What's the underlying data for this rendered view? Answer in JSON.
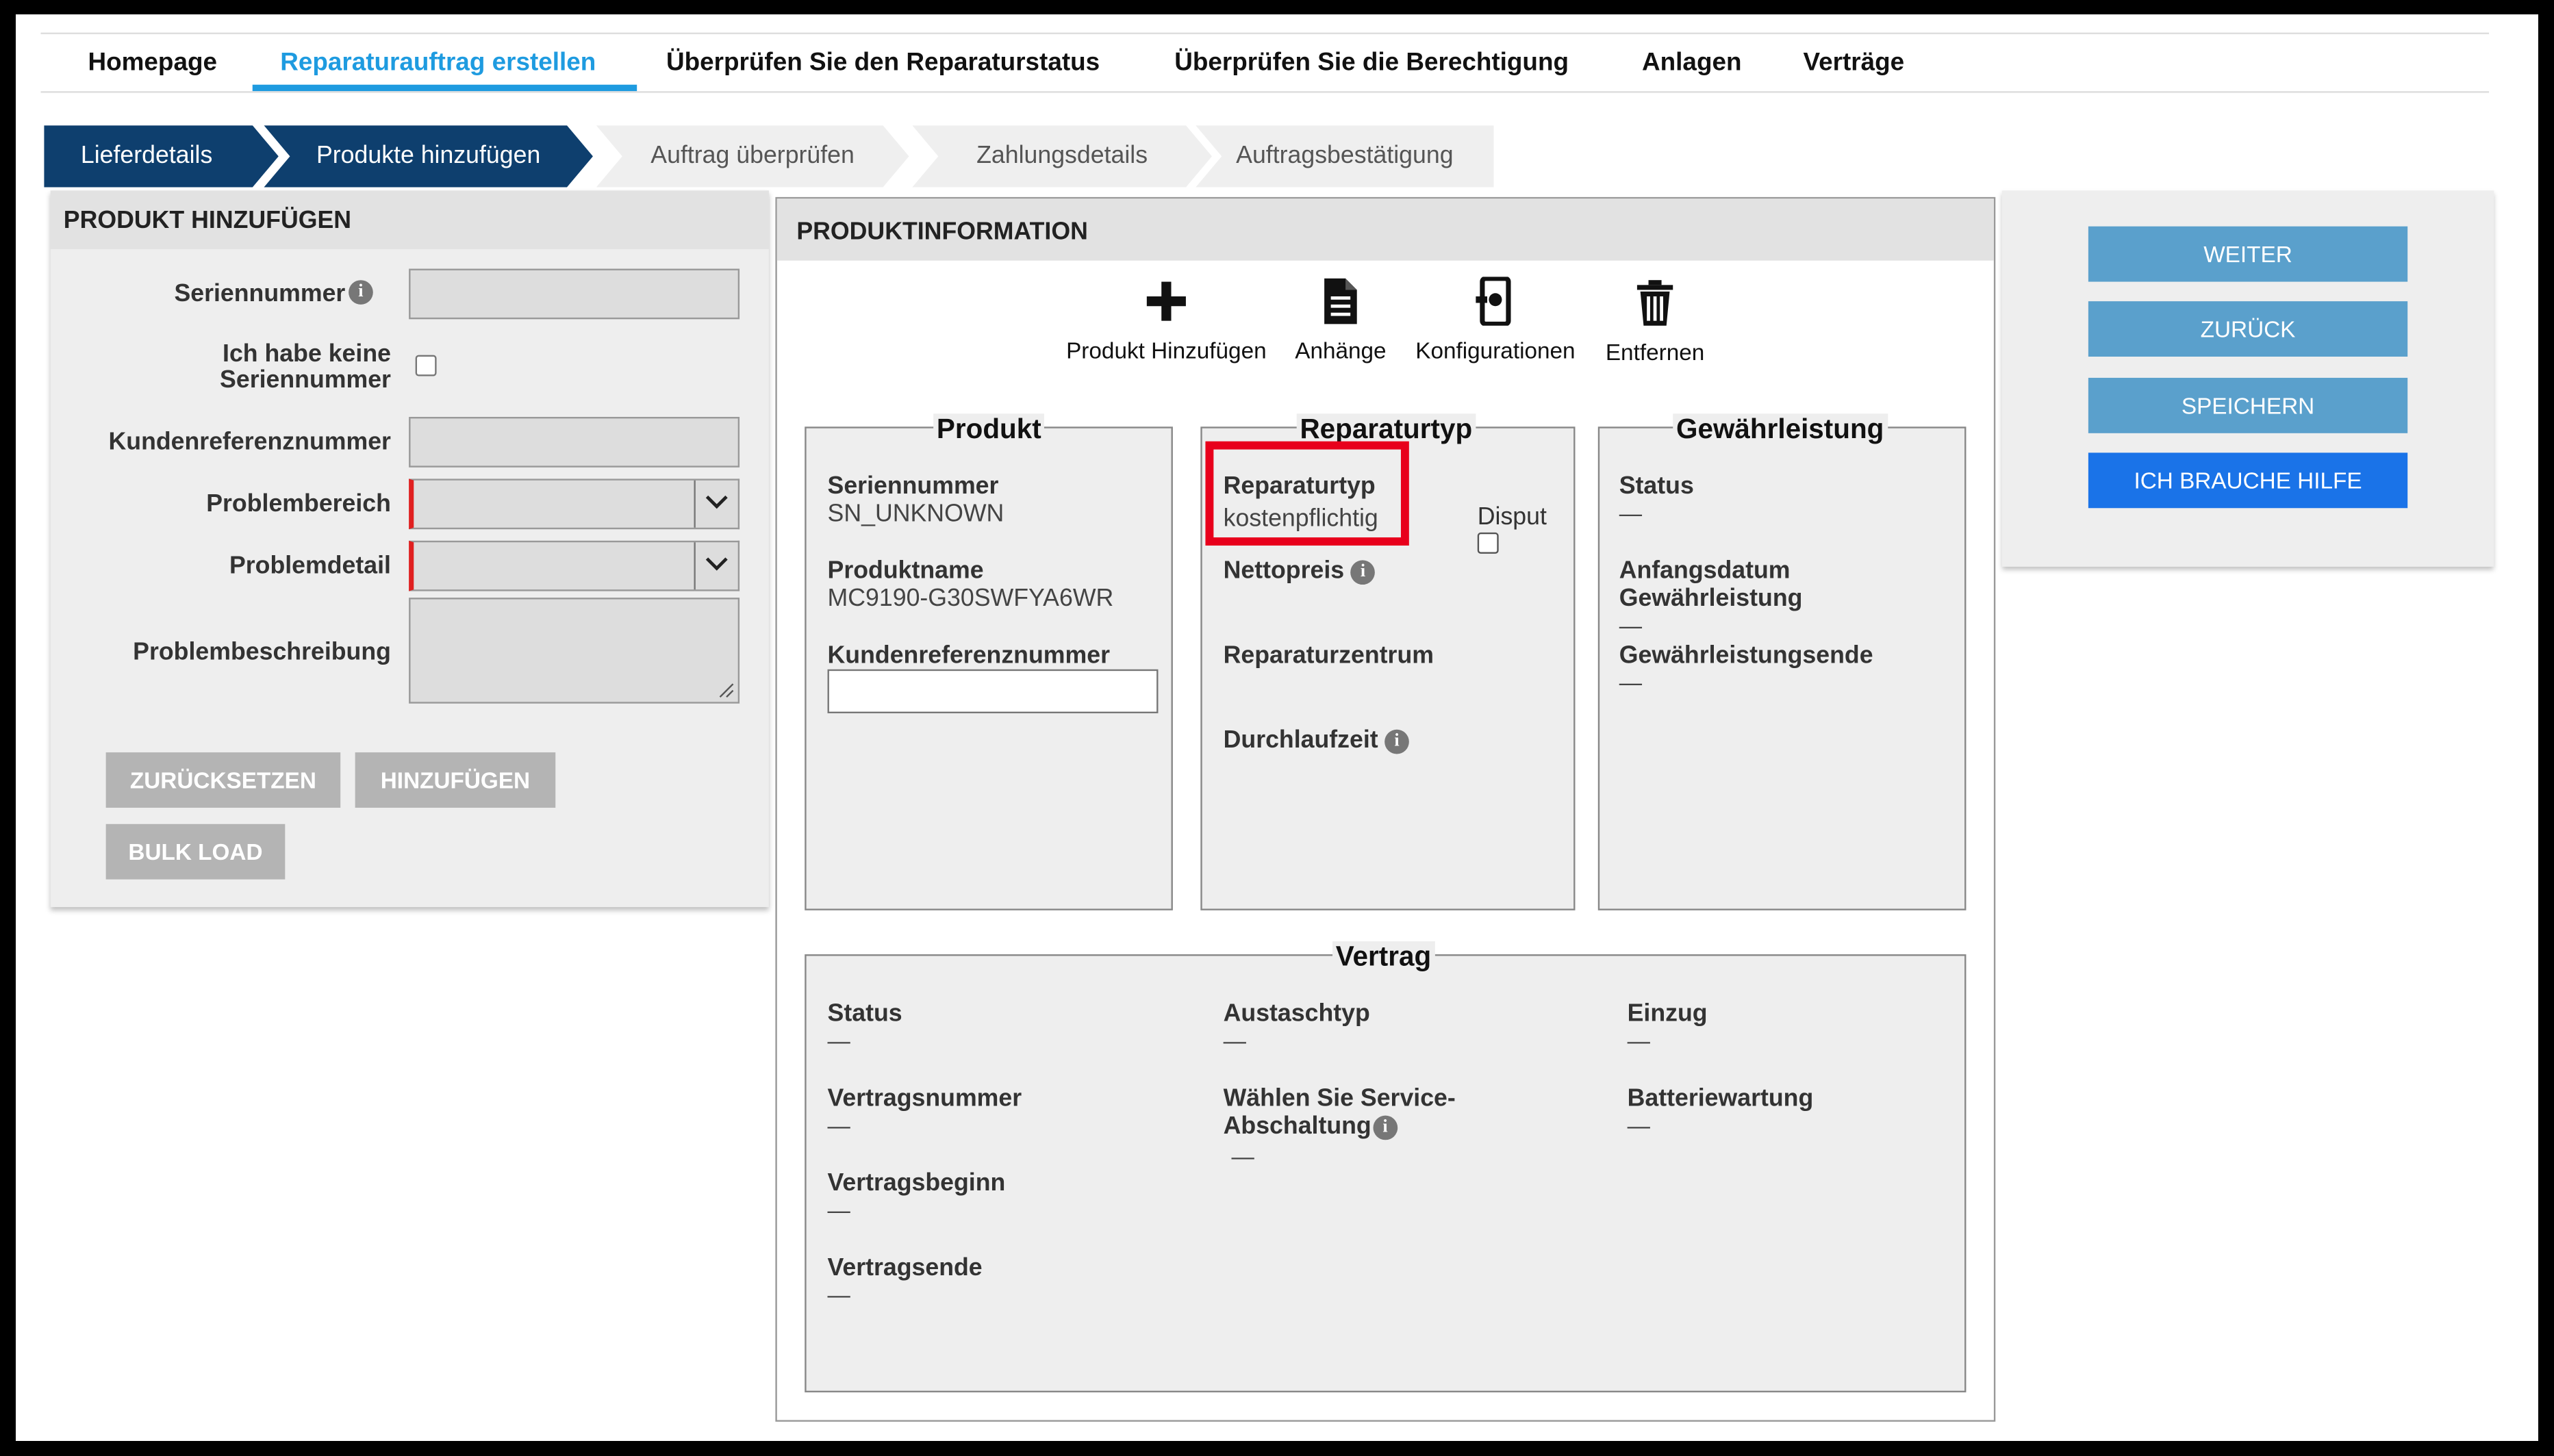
{
  "nav": {
    "items": [
      "Homepage",
      "Reparaturauftrag erstellen",
      "Überprüfen Sie den Reparaturstatus",
      "Überprüfen Sie die Berechtigung",
      "Anlagen",
      "Verträge"
    ]
  },
  "steps": [
    "Lieferdetails",
    "Produkte hinzufügen",
    "Auftrag überprüfen",
    "Zahlungsdetails",
    "Auftragsbestätigung"
  ],
  "left_panel": {
    "title": "PRODUKT HINZUFÜGEN",
    "serial_label": "Seriennummer",
    "no_serial_line1": "Ich habe keine",
    "no_serial_line2": "Seriennummer",
    "customer_ref_label": "Kundenreferenznummer",
    "problem_area_label": "Problembereich",
    "problem_detail_label": "Problemdetail",
    "problem_desc_label": "Problembeschreibung",
    "reset_button": "ZURÜCKSETZEN",
    "add_button": "HINZUFÜGEN",
    "bulk_button": "BULK LOAD"
  },
  "product_info": {
    "title": "PRODUKTINFORMATION",
    "tools": {
      "add": "Produkt Hinzufügen",
      "attachments": "Anhänge",
      "configurations": "Konfigurationen",
      "remove": "Entfernen"
    },
    "product": {
      "title": "Produkt",
      "serial_label": "Seriennummer",
      "serial_value": "SN_UNKNOWN",
      "name_label": "Produktname",
      "name_value": "MC9190-G30SWFYA6WR",
      "ref_label": "Kundenreferenznummer"
    },
    "repair_type": {
      "title": "Reparaturtyp",
      "type_label": "Reparaturtyp",
      "type_value": "kostenpflichtig",
      "dispute_label": "Disput",
      "net_price_label": "Nettopreis",
      "center_label": "Reparaturzentrum",
      "turnaround_label": "Durchlaufzeit"
    },
    "warranty": {
      "title": "Gewährleistung",
      "status_label": "Status",
      "status_value": "—",
      "start_label_1": "Anfangsdatum",
      "start_label_2": "Gewährleistung",
      "start_value": "—",
      "end_label": "Gewährleistungsende",
      "end_value": "—"
    },
    "contract": {
      "title": "Vertrag",
      "status_label": "Status",
      "status_value": "—",
      "number_label": "Vertragsnummer",
      "number_value": "—",
      "begin_label": "Vertragsbeginn",
      "begin_value": "—",
      "end_label": "Vertragsende",
      "end_value": "—",
      "exchange_label": "Austaschtyp",
      "exchange_value": "—",
      "shutdown_label_1": "Wählen Sie Service-",
      "shutdown_label_2": "Abschaltung",
      "shutdown_value": "—",
      "collection_label": "Einzug",
      "collection_value": "—",
      "battery_label": "Batteriewartung",
      "battery_value": "—"
    }
  },
  "actions": {
    "next": "WEITER",
    "back": "ZURÜCK",
    "save": "SPEICHERN",
    "help": "ICH BRAUCHE HILFE"
  },
  "colors": {
    "nav_active": "#1e9be0",
    "step_done": "#0e3f6e",
    "highlight": "#e8001c",
    "button_blue": "#5aa0cc",
    "button_primary": "#1a73e8"
  }
}
